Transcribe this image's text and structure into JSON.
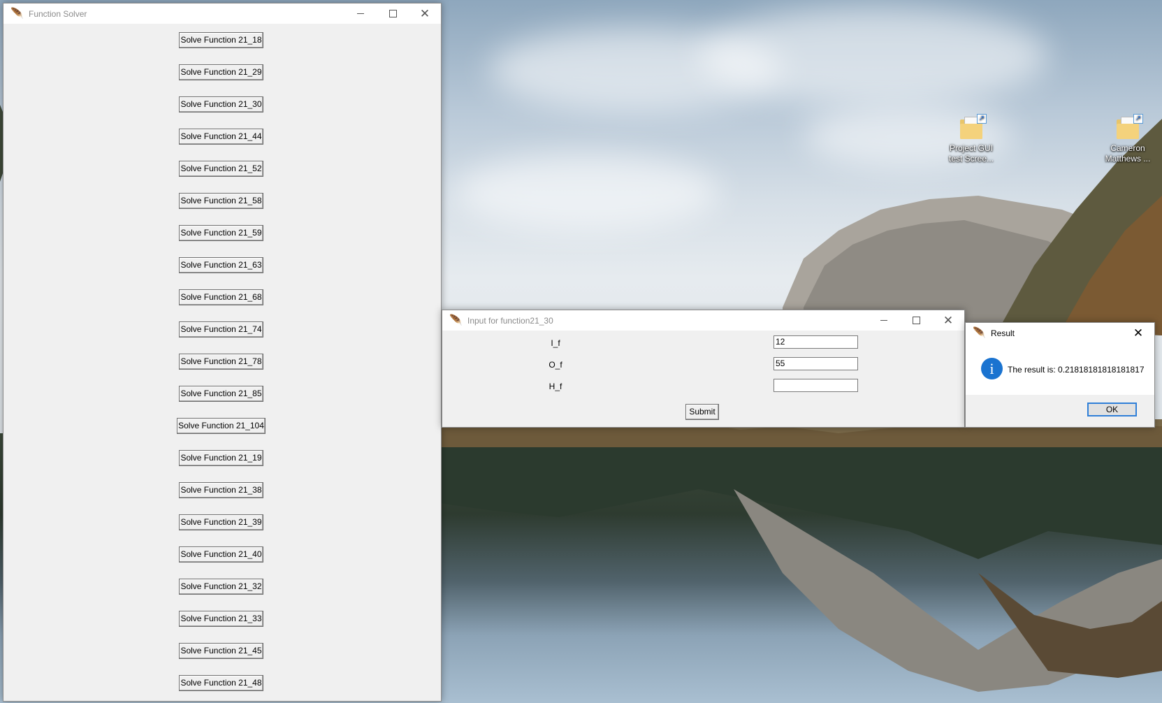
{
  "desktop": {
    "icons": [
      {
        "label": "Project GUI test Scree..."
      },
      {
        "label": "Cameron Matthews ..."
      }
    ]
  },
  "solver_window": {
    "title": "Function Solver",
    "buttons": [
      "Solve Function 21_18",
      "Solve Function 21_29",
      "Solve Function 21_30",
      "Solve Function 21_44",
      "Solve Function 21_52",
      "Solve Function 21_58",
      "Solve Function 21_59",
      "Solve Function 21_63",
      "Solve Function 21_68",
      "Solve Function 21_74",
      "Solve Function 21_78",
      "Solve Function 21_85",
      "Solve Function 21_104",
      "Solve Function 21_19",
      "Solve Function 21_38",
      "Solve Function 21_39",
      "Solve Function 21_40",
      "Solve Function 21_32",
      "Solve Function 21_33",
      "Solve Function 21_45",
      "Solve Function 21_48"
    ]
  },
  "input_window": {
    "title": "Input for function21_30",
    "fields": [
      {
        "label": "I_f",
        "value": "12"
      },
      {
        "label": "O_f",
        "value": "55"
      },
      {
        "label": "H_f",
        "value": ""
      }
    ],
    "submit_label": "Submit"
  },
  "result_dialog": {
    "title": "Result",
    "message": "The result is: 0.21818181818181817",
    "ok_label": "OK"
  }
}
